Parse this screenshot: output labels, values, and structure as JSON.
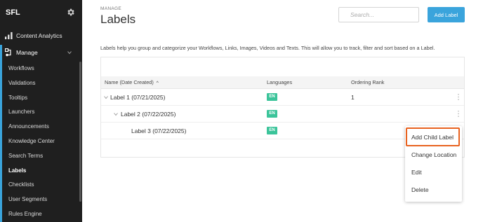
{
  "sidebar": {
    "brand": "SFL",
    "top_item": "Content Analytics",
    "section": "Manage",
    "items": [
      "Workflows",
      "Validations",
      "Tooltips",
      "Launchers",
      "Announcements",
      "Knowledge Center",
      "Search Terms",
      "Labels",
      "Checklists",
      "User Segments",
      "Rules Engine"
    ],
    "active_item": "Labels"
  },
  "header": {
    "section_label": "MANAGE",
    "title": "Labels",
    "search_placeholder": "Search...",
    "add_button": "Add Label"
  },
  "description": "Labels help you group and categorize your Workflows, Links, Images, Videos and Texts. This will allow you to track, filter and sort based on a Label.",
  "table": {
    "columns": [
      "Name (Date Created)",
      "Languages",
      "Ordering Rank"
    ],
    "sort_indicator": "^",
    "rows": [
      {
        "name": "Label 1 (07/21/2025)",
        "language": "EN",
        "rank": "1"
      },
      {
        "name": "Label 2 (07/22/2025)",
        "language": "EN",
        "rank": ""
      },
      {
        "name": "Label 3 (07/22/2025)",
        "language": "EN",
        "rank": ""
      }
    ]
  },
  "context_menu": {
    "items": [
      "Add Child Label",
      "Change Location",
      "Edit",
      "Delete"
    ],
    "highlighted": "Add Child Label"
  },
  "colors": {
    "sidebar_bg": "#1f1f1f",
    "accent": "#3aa4dc",
    "badge": "#3bc49a",
    "highlight": "#e8621f"
  }
}
